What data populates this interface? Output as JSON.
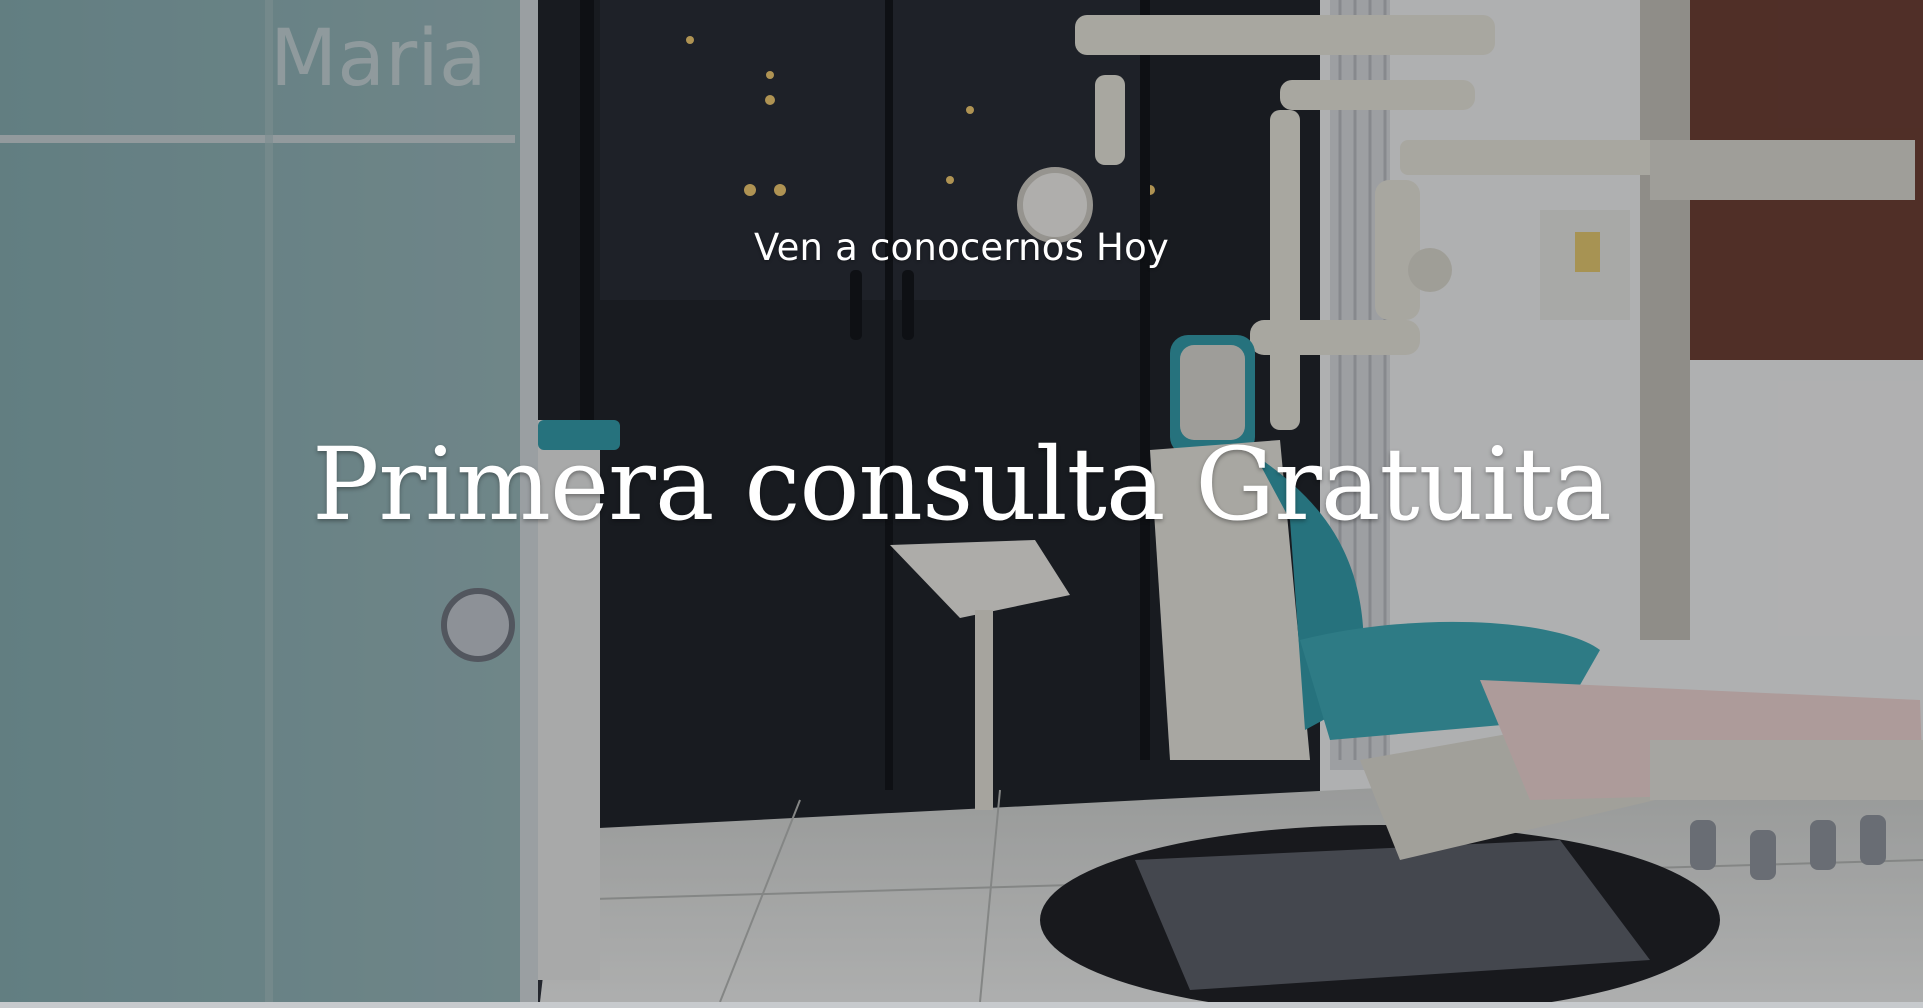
{
  "hero": {
    "subtitle": "Ven a conocernos Hoy",
    "headline": "Primera consulta Gratuita",
    "background_image": "dental-clinic-office-photo",
    "glass_sign_text": "Maria"
  },
  "colors": {
    "text": "#ffffff",
    "overlay": "#14161e",
    "chair_teal": "#2e9aa6",
    "floor": "#e4e4e0"
  }
}
